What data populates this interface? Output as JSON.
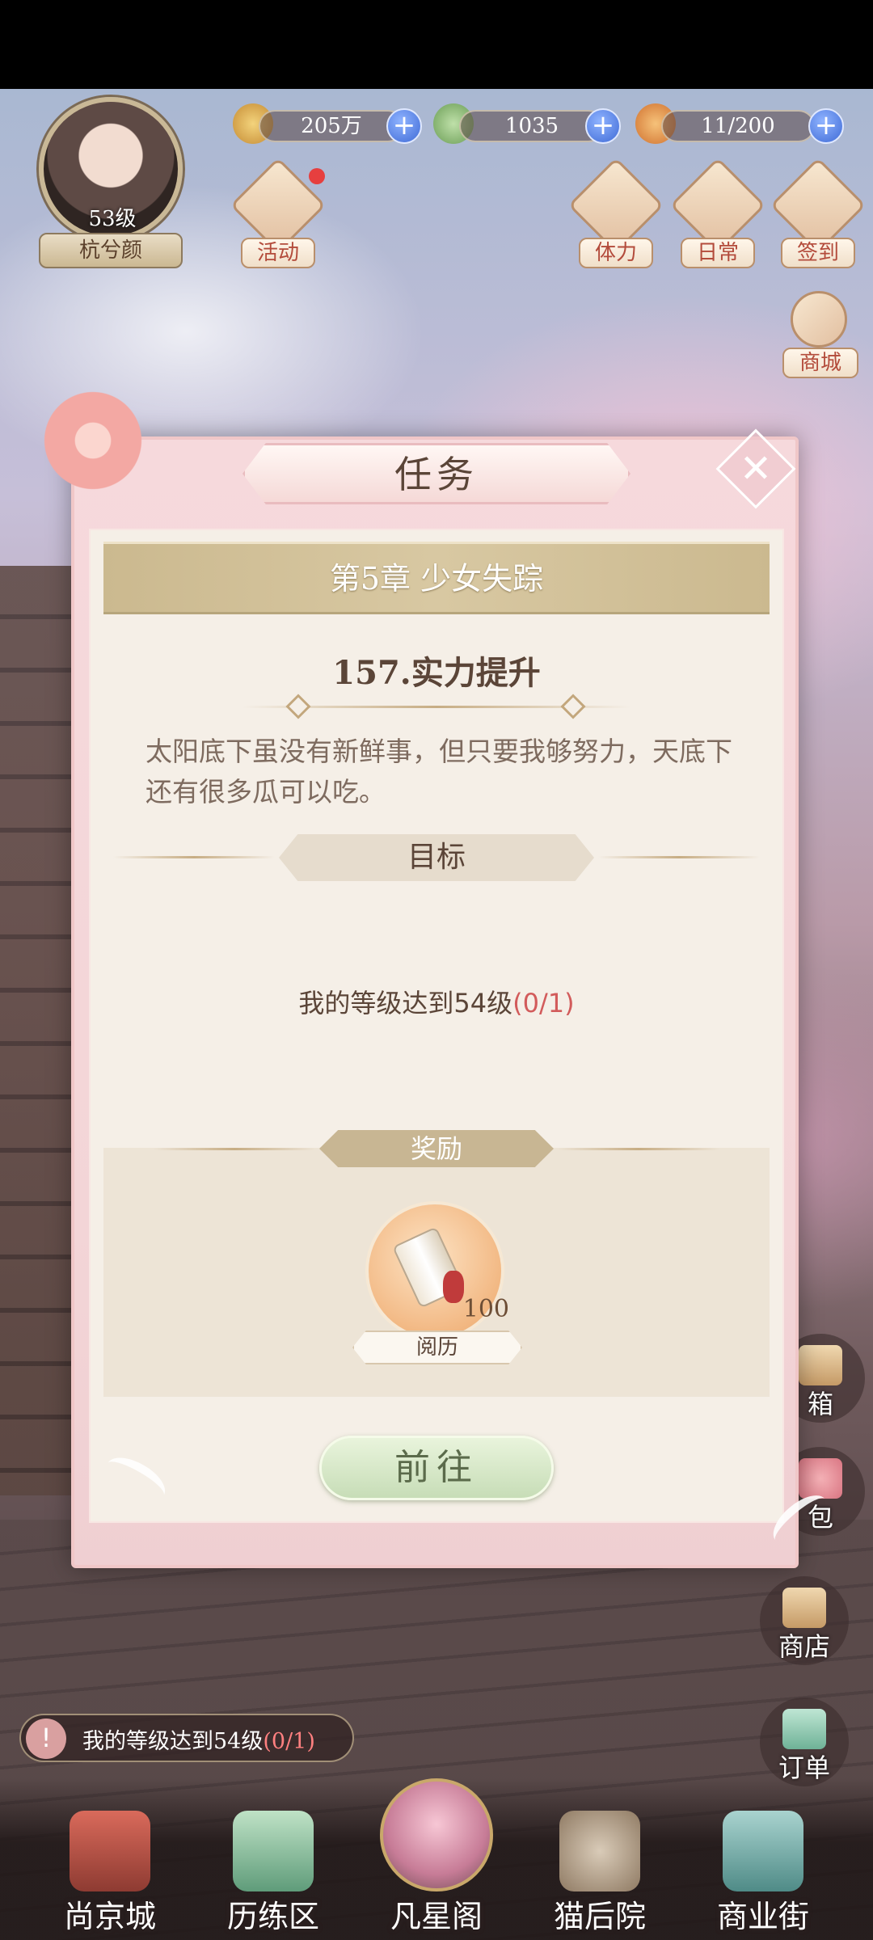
{
  "player": {
    "level": "53级",
    "name": "杭兮颜"
  },
  "resources": [
    {
      "value": "205万",
      "icon": "paw-coin-icon"
    },
    {
      "value": "1035",
      "icon": "jade-frog-icon"
    },
    {
      "value": "11/200",
      "icon": "bun-stamina-icon"
    }
  ],
  "hud_buttons": {
    "activity": "活动",
    "stamina": "体力",
    "daily": "日常",
    "checkin": "签到",
    "shop": "商城"
  },
  "modal": {
    "title": "任务",
    "close_icon": "close-icon",
    "chapter": "第5章 少女失踪",
    "task_name": "157.实力提升",
    "description": "太阳底下虽没有新鲜事，但只要我够努力，天底下还有很多瓜可以吃。",
    "goal_label": "目标",
    "goal_text": "我的等级达到54级",
    "goal_progress": "(0/1)",
    "reward_label": "奖励",
    "reward": {
      "name": "阅历",
      "count": "100",
      "icon": "scroll-icon"
    },
    "go_button": "前往"
  },
  "side_buttons": {
    "mailbox": "箱",
    "bag": "包",
    "store": "商店",
    "orders": "订单"
  },
  "tracker": {
    "text": "我的等级达到54级",
    "progress": "(0/1)"
  },
  "bottom_nav": [
    {
      "label": "尚京城",
      "icon": "palace-icon"
    },
    {
      "label": "历练区",
      "icon": "mountain-icon"
    },
    {
      "label": "凡星阁",
      "icon": "cherry-tree-icon"
    },
    {
      "label": "猫后院",
      "icon": "cat-icon"
    },
    {
      "label": "商业街",
      "icon": "gate-icon"
    }
  ],
  "colors": {
    "accent_red": "#d25b5b",
    "plus_blue": "#3f6bd6",
    "panel_pink": "#f6d9dc",
    "gold": "#c8b693"
  }
}
